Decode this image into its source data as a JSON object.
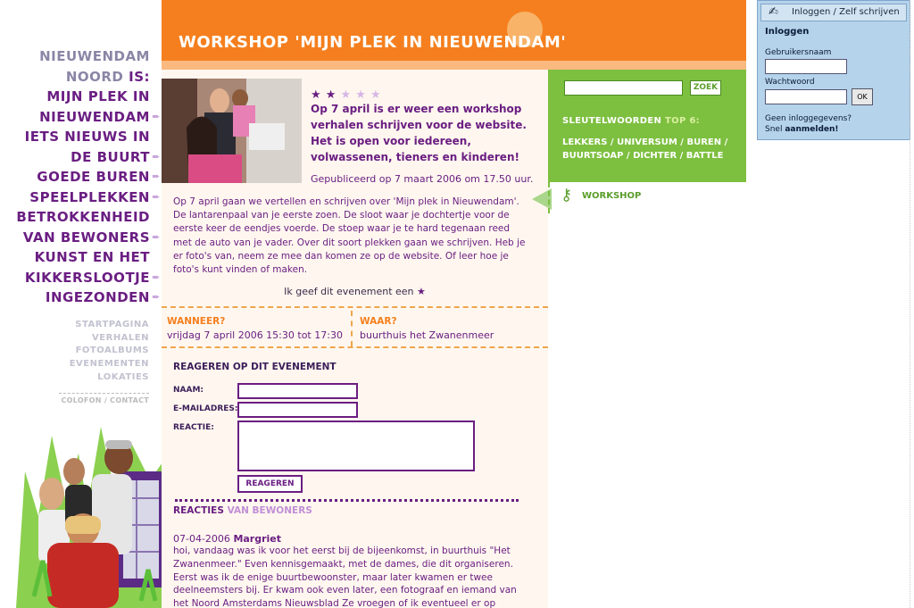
{
  "nav": {
    "head1": "NIEUWENDAM",
    "head2": "NOORD",
    "head2b": "IS:",
    "items": [
      "MIJN PLEK IN",
      "NIEUWENDAM",
      "IETS NIEUWS IN",
      "DE BUURT",
      "GOEDE BUREN",
      "SPEELPLEKKEN",
      "BETROKKENHEID",
      "VAN BEWONERS",
      "KUNST EN HET",
      "KIKKERSLOOTJE",
      "INGEZONDEN"
    ],
    "sub": [
      "STARTPAGINA",
      "VERHALEN",
      "FOTOALBUMS",
      "EVENEMENTEN",
      "LOKATIES"
    ],
    "colofon": "COLOFON / CONTACT"
  },
  "header": {
    "title": "WORKSHOP 'MIJN PLEK IN NIEUWENDAM'"
  },
  "event": {
    "rating": 2,
    "rating_max": 5,
    "intro": "Op 7 april is er weer een workshop verhalen schrijven voor de website. Het is open voor iedereen, volwassenen, tieners en kinderen!",
    "published": "Gepubliceerd op 7 maart 2006 om 17.50 uur.",
    "body": "Op 7 april gaan we vertellen en schrijven over 'Mijn plek in Nieuwendam'. De lantarenpaal van je eerste zoen. De sloot waar je dochtertje voor de eerste keer de eendjes voerde. De stoep waar je te hard tegenaan reed met de auto van je vader. Over dit soort plekken gaan we schrijven. Heb je er foto's van, neem ze mee dan komen ze op de website. Of leer hoe je foto's kunt vinden of maken.",
    "rate_label": "Ik geef dit evenement een",
    "when_label": "WANNEER?",
    "when": "vrijdag 7 april 2006 15:30 tot 17:30",
    "where_label": "WAAR?",
    "where": "buurthuis het Zwanenmeer"
  },
  "form": {
    "title": "REAGEREN OP DIT EVENEMENT",
    "name_label": "NAAM:",
    "email_label": "E-MAILADRES:",
    "reaction_label": "REACTIE:",
    "submit": "REAGEREN"
  },
  "reactions": {
    "title1": "REACTIES",
    "title2": "VAN BEWONERS",
    "date": "07-04-2006",
    "author": "Margriet",
    "text": "hoi, vandaag was ik voor het eerst bij de bijeenkomst, in buurthuis \"Het Zwanenmeer.\" Even kennisgemaakt, met de dames, die dit organiseren. Eerst was ik de enige buurtbewoonster, maar later kwamen er twee deelneemsters bij. Er kwam ook even later, een fotograaf en iemand van het Noord Amsterdams Nieuwsblad Ze vroegen of ik eventueel er op wilde, qua"
  },
  "search": {
    "button": "ZOEK",
    "value": ""
  },
  "keywords": {
    "label1": "SLEUTELWOORDEN",
    "label2": "TOP 6:",
    "items": [
      "LEKKERS",
      "UNIVERSUM",
      "BUREN",
      "BUURTSOAP",
      "DICHTER",
      "BATTLE"
    ]
  },
  "tag": {
    "label": "WORKSHOP"
  },
  "login": {
    "header": "Inloggen / Zelf schrijven",
    "title": "Inloggen",
    "user_label": "Gebruikersnaam",
    "pass_label": "Wachtwoord",
    "ok": "OK",
    "no_account": "Geen inloggegevens?",
    "signup_prefix": "Snel",
    "signup": "aanmelden!"
  }
}
